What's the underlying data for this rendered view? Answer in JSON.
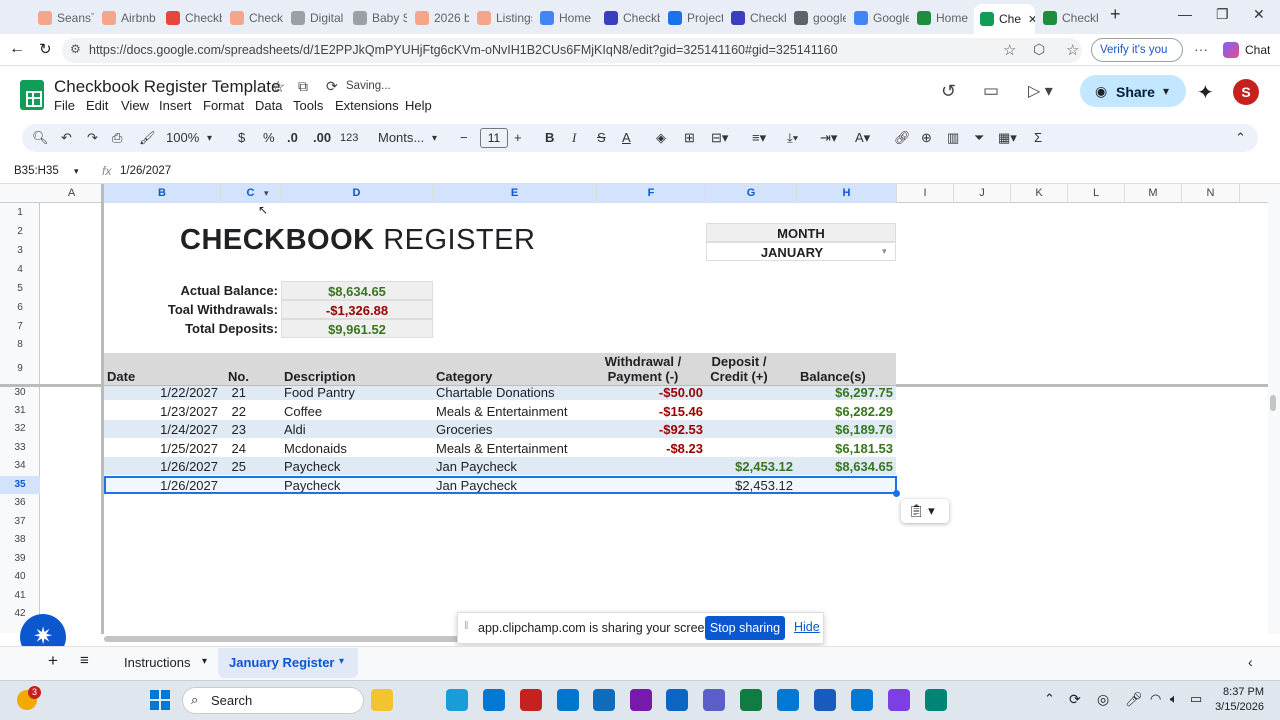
{
  "browser": {
    "tabs": [
      {
        "label": "SeansTe",
        "color": "#f4a58a"
      },
      {
        "label": "Airbnb",
        "color": "#f4a58a"
      },
      {
        "label": "Checkb",
        "color": "#e8453c"
      },
      {
        "label": "Checkb",
        "color": "#f4a58a"
      },
      {
        "label": "Digital",
        "color": "#9aa0a6"
      },
      {
        "label": "Baby S",
        "color": "#9aa0a6"
      },
      {
        "label": "2026 b",
        "color": "#f4a58a"
      },
      {
        "label": "Listings",
        "color": "#f4a58a"
      },
      {
        "label": "Home",
        "color": "#4285f4"
      },
      {
        "label": "Checkb",
        "color": "#3b3fbf"
      },
      {
        "label": "Projects",
        "color": "#1a73e8"
      },
      {
        "label": "Checkb",
        "color": "#3b3fbf"
      },
      {
        "label": "google",
        "color": "#5f6368"
      },
      {
        "label": "Google",
        "color": "#4285f4"
      },
      {
        "label": "Home",
        "color": "#1e8e3e"
      },
      {
        "label": "Che",
        "color": "#0f9d58",
        "active": true
      },
      {
        "label": "Checkb",
        "color": "#1e8e3e"
      }
    ],
    "url": "https://docs.google.com/spreadsheets/d/1E2PPJkQmPYUHjFtg6cKVm-oNvIH1B2CUs6FMjKIqN8/edit?gid=325141160#gid=325141160",
    "verify_label": "Verify it's you",
    "chat_label": "Chat"
  },
  "sheets": {
    "title": "Checkbook Register Template",
    "status": "Saving...",
    "menus": [
      "File",
      "Edit",
      "View",
      "Insert",
      "Format",
      "Data",
      "Tools",
      "Extensions",
      "Help"
    ],
    "share_label": "Share",
    "avatar_letter": "S",
    "toolbar": {
      "zoom": "100%",
      "currency": "$",
      "percent": "%",
      "dec_minus": ".0",
      "dec_plus": ".00",
      "number_format": "123",
      "font": "Monts...",
      "font_size": "11"
    },
    "name_box": "B35:H35",
    "formula": "1/26/2027",
    "columns": [
      "A",
      "B",
      "C",
      "D",
      "E",
      "F",
      "G",
      "H",
      "I",
      "J",
      "K",
      "L",
      "M",
      "N"
    ],
    "row_numbers": [
      "1",
      "2",
      "3",
      "4",
      "5",
      "6",
      "7",
      "8",
      "9",
      "30",
      "31",
      "32",
      "33",
      "34",
      "35",
      "36",
      "37",
      "38",
      "39",
      "40",
      "41",
      "42"
    ]
  },
  "register": {
    "heading_bold": "CHECKBOOK",
    "heading_light": "REGISTER",
    "month_label": "MONTH",
    "month_value": "JANUARY",
    "summary": [
      {
        "label": "Actual Balance:",
        "value": "$8,634.65",
        "tone": "green"
      },
      {
        "label": "Toal Withdrawals:",
        "value": "-$1,326.88",
        "tone": "red"
      },
      {
        "label": "Total Deposits:",
        "value": "$9,961.52",
        "tone": "green"
      }
    ],
    "headers": {
      "date": "Date",
      "no": "No.",
      "description": "Description",
      "category": "Category",
      "withdrawal": "Withdrawal /\nPayment (-)",
      "deposit": "Deposit /\nCredit (+)",
      "balance": "Balance(s)"
    },
    "rows": [
      {
        "date": "1/22/2027",
        "no": "21",
        "description": "Food Pantry",
        "category": "Chartable Donations",
        "withdrawal": "-$50.00",
        "deposit": "",
        "balance": "$6,297.75"
      },
      {
        "date": "1/23/2027",
        "no": "22",
        "description": "Coffee",
        "category": "Meals & Entertainment",
        "withdrawal": "-$15.46",
        "deposit": "",
        "balance": "$6,282.29"
      },
      {
        "date": "1/24/2027",
        "no": "23",
        "description": "Aldi",
        "category": "Groceries",
        "withdrawal": "-$92.53",
        "deposit": "",
        "balance": "$6,189.76"
      },
      {
        "date": "1/25/2027",
        "no": "24",
        "description": "Mcdonaids",
        "category": "Meals & Entertainment",
        "withdrawal": "-$8.23",
        "deposit": "",
        "balance": "$6,181.53"
      },
      {
        "date": "1/26/2027",
        "no": "25",
        "description": "Paycheck",
        "category": "Jan Paycheck",
        "withdrawal": "",
        "deposit": "$2,453.12",
        "balance": "$8,634.65"
      },
      {
        "date": "1/26/2027",
        "no": "",
        "description": "Paycheck",
        "category": "Jan Paycheck",
        "withdrawal": "",
        "deposit": "$2,453.12",
        "balance": ""
      }
    ]
  },
  "share_notice": {
    "text": "app.clipchamp.com is sharing your screen.",
    "stop": "Stop sharing",
    "hide": "Hide"
  },
  "sheet_tabs": [
    {
      "label": "Instructions"
    },
    {
      "label": "January Register",
      "active": true
    }
  ],
  "taskbar": {
    "search": "Search",
    "time": "8:37 PM",
    "date": "3/15/2026",
    "badge": "3"
  },
  "colors": {
    "green": "#38761d",
    "red": "#990000",
    "accent": "#0b57d0",
    "band": "#dfeaf5"
  }
}
